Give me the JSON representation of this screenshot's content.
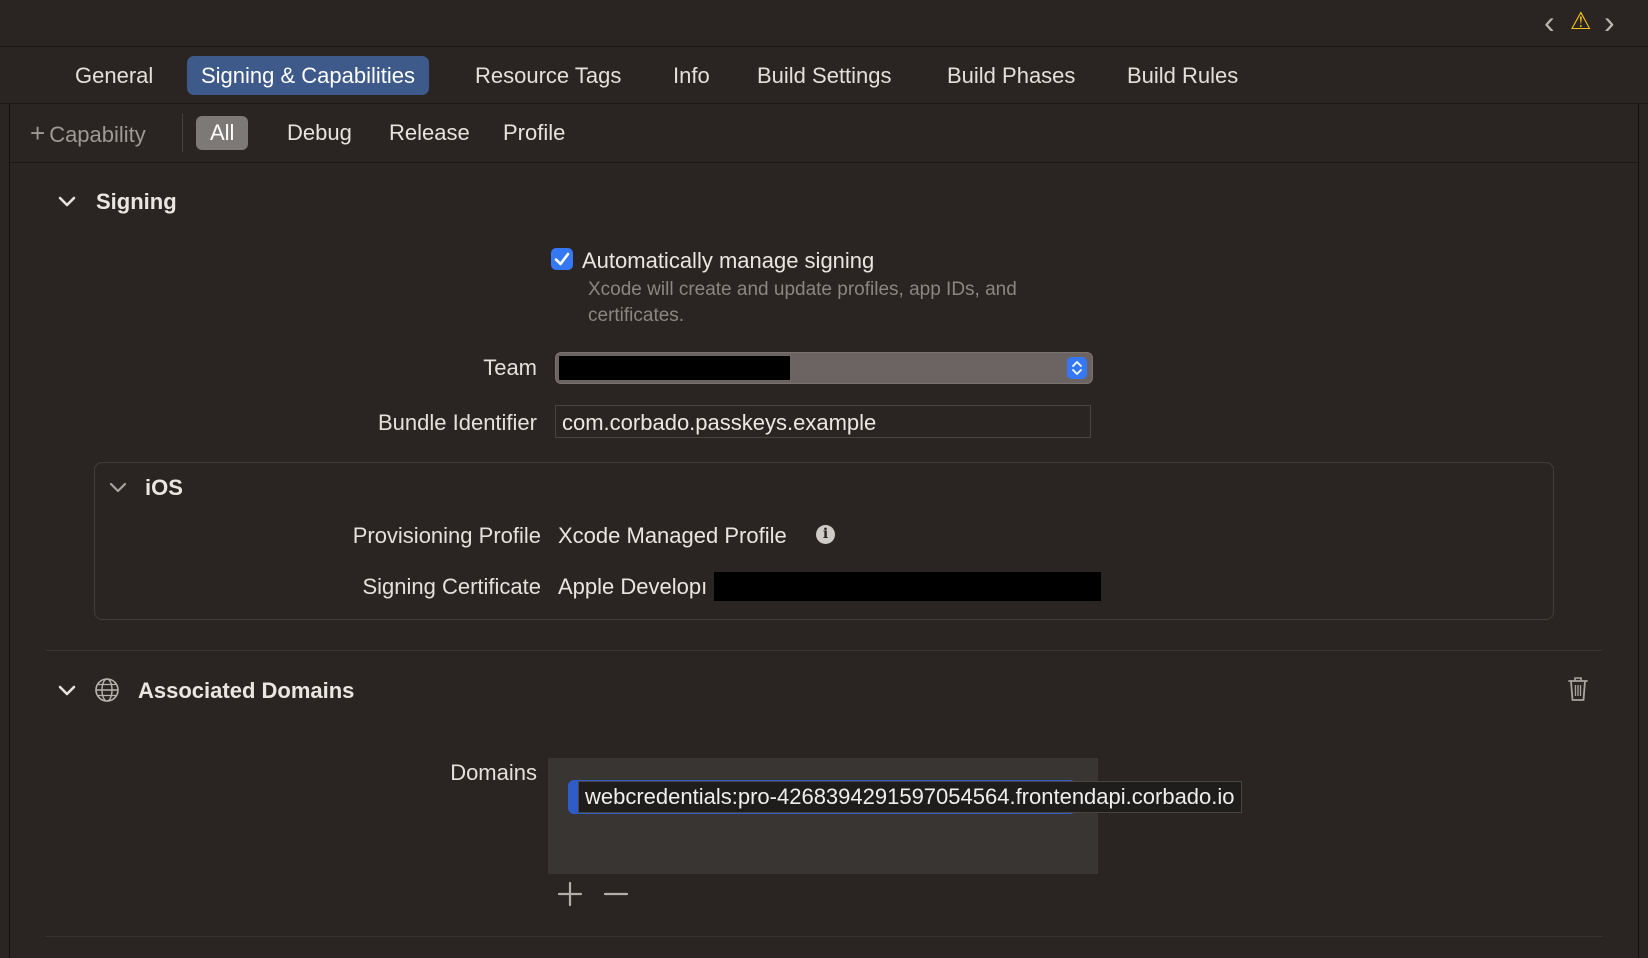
{
  "window": {
    "nav_back": "‹",
    "nav_forward": "›",
    "warning": "⚠"
  },
  "tabs": [
    {
      "label": "General"
    },
    {
      "label": "Signing & Capabilities"
    },
    {
      "label": "Resource Tags"
    },
    {
      "label": "Info"
    },
    {
      "label": "Build Settings"
    },
    {
      "label": "Build Phases"
    },
    {
      "label": "Build Rules"
    }
  ],
  "subbar": {
    "add_capability": "Capability",
    "filters": [
      {
        "label": "All"
      },
      {
        "label": "Debug"
      },
      {
        "label": "Release"
      },
      {
        "label": "Profile"
      }
    ]
  },
  "signing": {
    "title": "Signing",
    "auto_manage_label": "Automatically manage signing",
    "auto_manage_checked": true,
    "auto_manage_desc_line1": "Xcode will create and update profiles, app IDs, and",
    "auto_manage_desc_line2": "certificates.",
    "team_label": "Team",
    "bundle_id_label": "Bundle Identifier",
    "bundle_id_value": "com.corbado.passkeys.example",
    "ios": {
      "title": "iOS",
      "provisioning_label": "Provisioning Profile",
      "provisioning_value": "Xcode Managed Profile",
      "certificate_label": "Signing Certificate",
      "certificate_value": "Apple Developı"
    }
  },
  "associated_domains": {
    "title": "Associated Domains",
    "domains_label": "Domains",
    "domain_value": "webcredentials:pro-4268394291597054564.frontendapi.corbado.io"
  },
  "colors": {
    "background": "#2a2522",
    "accent": "#3d5a8a",
    "checkbox": "#3478f6",
    "warning": "#f5c518"
  }
}
